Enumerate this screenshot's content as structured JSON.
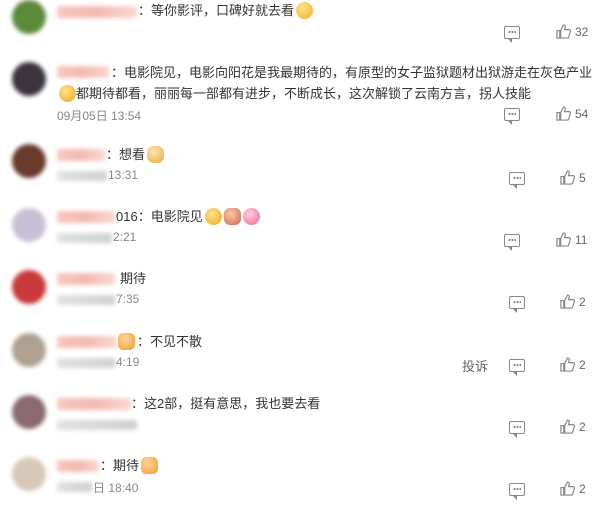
{
  "comments": [
    {
      "text": "：等你影评，口碑好就去看",
      "emoji": "grin",
      "time": "",
      "likes": "32",
      "avatar_color": "#5b8a3c"
    },
    {
      "text": "：电影院见，电影向阳花是我最期待的，有原型的女子监狱题材出狱游走在灰色产业",
      "text2": "都期待都看，丽丽每一部都有进步，不断成长，这次解锁了云南方言，拐人技能",
      "emoji": "face",
      "time": "09月05日 13:54",
      "likes": "54",
      "avatar_color": "#3d3440"
    },
    {
      "text": "：想看",
      "emoji": "hand",
      "time": "13:31",
      "likes": "5",
      "avatar_color": "#6a3a2c"
    },
    {
      "text": "016：电影院见",
      "emoji": "face",
      "time": "2:21",
      "likes": "11",
      "avatar_color": "#c8c0d8"
    },
    {
      "text": "期待",
      "emoji": "",
      "time": "7:35",
      "likes": "2",
      "avatar_color": "#c83a3a"
    },
    {
      "text": "：不见不散",
      "emoji": "crown",
      "time": "4:19",
      "likes": "2",
      "avatar_color": "#b0a090",
      "report": "投诉"
    },
    {
      "text": "：这2部，挺有意思，我也要去看",
      "emoji": "",
      "time": "",
      "likes": "2",
      "avatar_color": "#8a6a70"
    },
    {
      "text": "：期待",
      "emoji": "crown",
      "time": "日 18:40",
      "likes": "2",
      "avatar_color": "#d8c8b8"
    }
  ],
  "colors": {
    "text": "#333333",
    "meta": "#888888",
    "icon": "#888888"
  },
  "icons": {
    "comment": "comment-icon",
    "like": "thumbs-up-icon"
  }
}
